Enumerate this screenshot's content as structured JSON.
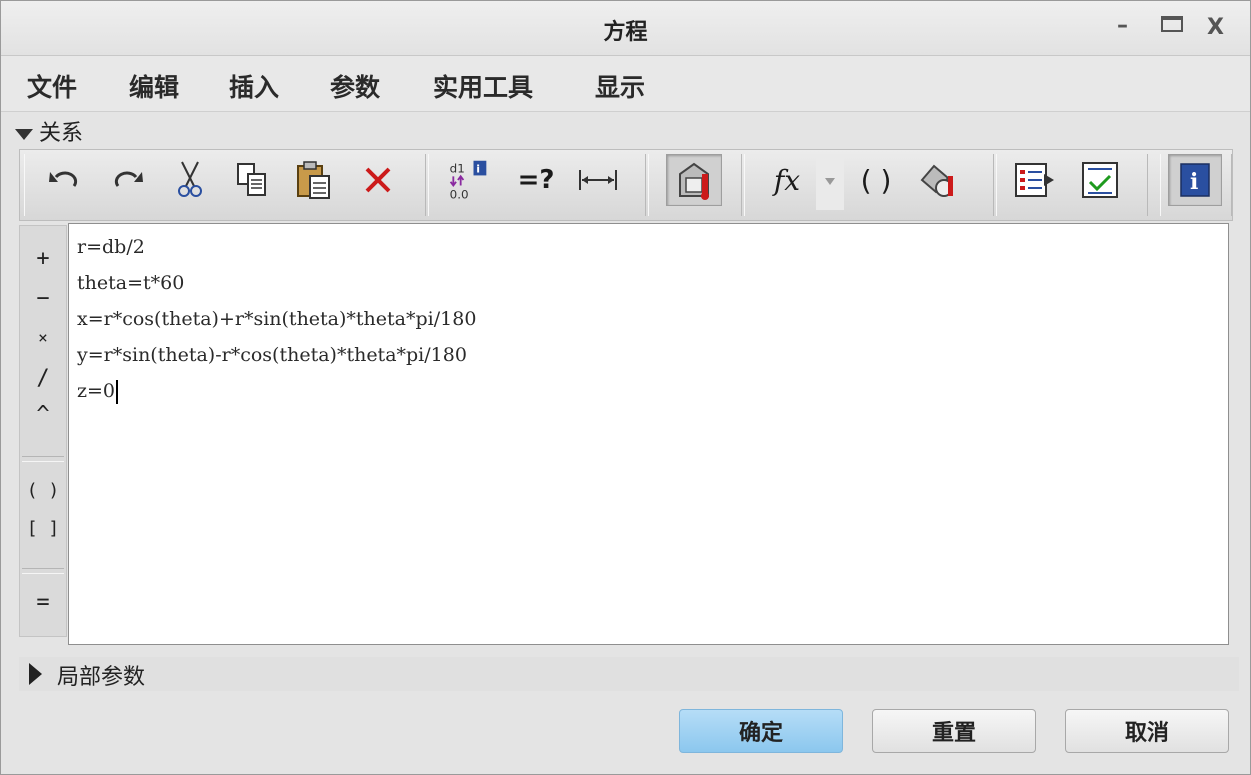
{
  "window": {
    "title": "方程",
    "controls": {
      "minimize": "–",
      "close": "X"
    }
  },
  "menu": {
    "items": [
      "文件",
      "编辑",
      "插入",
      "参数",
      "实用工具",
      "显示"
    ]
  },
  "relations_section": {
    "label": "关系"
  },
  "toolbar": {
    "icons": [
      "undo-icon",
      "redo-icon",
      "cut-icon",
      "copy-icon",
      "paste-icon",
      "delete-icon",
      "dimension-toggle-icon",
      "evaluate-icon",
      "insert-dimension-icon",
      "sort-relations-icon",
      "function-icon",
      "parameters-icon",
      "execute-verify-icon",
      "show-details-icon",
      "verify-relations-icon",
      "info-icon"
    ],
    "evaluate_label": "=?",
    "function_label": "fx",
    "dimension_label_top": "d1",
    "dimension_label_bottom": "0.0",
    "brackets_label": "( )",
    "info_label": "i"
  },
  "operators": [
    "+",
    "−",
    "×",
    "/",
    "^",
    "( )",
    "[ ]",
    "="
  ],
  "editor": {
    "lines": [
      "r=db/2",
      "theta=t*60",
      "x=r*cos(theta)+r*sin(theta)*theta*pi/180",
      "y=r*sin(theta)-r*cos(theta)*theta*pi/180",
      "z=0"
    ]
  },
  "local_params": {
    "label": "局部参数"
  },
  "buttons": {
    "ok": "确定",
    "reset": "重置",
    "cancel": "取消"
  },
  "colors": {
    "primary_button": "#9fd1f2",
    "delete_red": "#cc1a1a",
    "info_blue": "#2a4fa0"
  }
}
